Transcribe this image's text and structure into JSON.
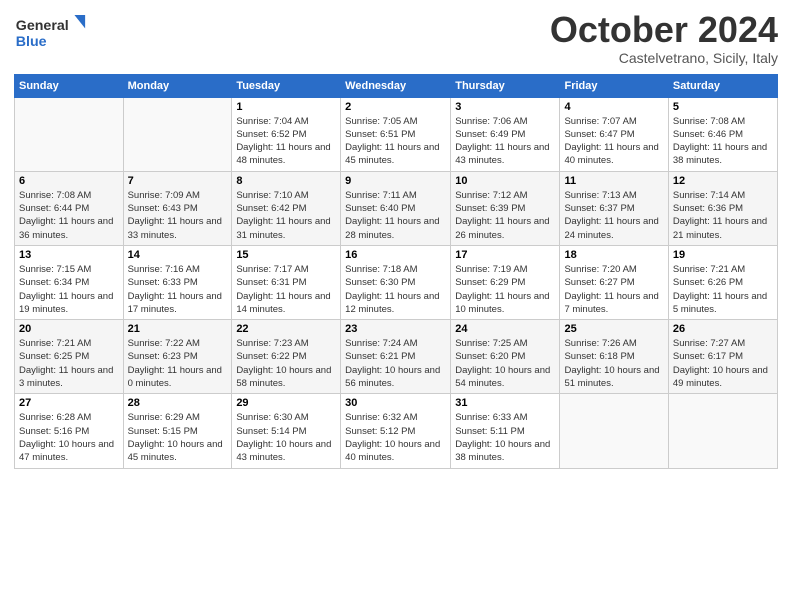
{
  "header": {
    "logo_general": "General",
    "logo_blue": "Blue",
    "title": "October 2024",
    "location": "Castelvetrano, Sicily, Italy"
  },
  "weekdays": [
    "Sunday",
    "Monday",
    "Tuesday",
    "Wednesday",
    "Thursday",
    "Friday",
    "Saturday"
  ],
  "weeks": [
    [
      {
        "day": "",
        "sunrise": "",
        "sunset": "",
        "daylight": ""
      },
      {
        "day": "",
        "sunrise": "",
        "sunset": "",
        "daylight": ""
      },
      {
        "day": "1",
        "sunrise": "Sunrise: 7:04 AM",
        "sunset": "Sunset: 6:52 PM",
        "daylight": "Daylight: 11 hours and 48 minutes."
      },
      {
        "day": "2",
        "sunrise": "Sunrise: 7:05 AM",
        "sunset": "Sunset: 6:51 PM",
        "daylight": "Daylight: 11 hours and 45 minutes."
      },
      {
        "day": "3",
        "sunrise": "Sunrise: 7:06 AM",
        "sunset": "Sunset: 6:49 PM",
        "daylight": "Daylight: 11 hours and 43 minutes."
      },
      {
        "day": "4",
        "sunrise": "Sunrise: 7:07 AM",
        "sunset": "Sunset: 6:47 PM",
        "daylight": "Daylight: 11 hours and 40 minutes."
      },
      {
        "day": "5",
        "sunrise": "Sunrise: 7:08 AM",
        "sunset": "Sunset: 6:46 PM",
        "daylight": "Daylight: 11 hours and 38 minutes."
      }
    ],
    [
      {
        "day": "6",
        "sunrise": "Sunrise: 7:08 AM",
        "sunset": "Sunset: 6:44 PM",
        "daylight": "Daylight: 11 hours and 36 minutes."
      },
      {
        "day": "7",
        "sunrise": "Sunrise: 7:09 AM",
        "sunset": "Sunset: 6:43 PM",
        "daylight": "Daylight: 11 hours and 33 minutes."
      },
      {
        "day": "8",
        "sunrise": "Sunrise: 7:10 AM",
        "sunset": "Sunset: 6:42 PM",
        "daylight": "Daylight: 11 hours and 31 minutes."
      },
      {
        "day": "9",
        "sunrise": "Sunrise: 7:11 AM",
        "sunset": "Sunset: 6:40 PM",
        "daylight": "Daylight: 11 hours and 28 minutes."
      },
      {
        "day": "10",
        "sunrise": "Sunrise: 7:12 AM",
        "sunset": "Sunset: 6:39 PM",
        "daylight": "Daylight: 11 hours and 26 minutes."
      },
      {
        "day": "11",
        "sunrise": "Sunrise: 7:13 AM",
        "sunset": "Sunset: 6:37 PM",
        "daylight": "Daylight: 11 hours and 24 minutes."
      },
      {
        "day": "12",
        "sunrise": "Sunrise: 7:14 AM",
        "sunset": "Sunset: 6:36 PM",
        "daylight": "Daylight: 11 hours and 21 minutes."
      }
    ],
    [
      {
        "day": "13",
        "sunrise": "Sunrise: 7:15 AM",
        "sunset": "Sunset: 6:34 PM",
        "daylight": "Daylight: 11 hours and 19 minutes."
      },
      {
        "day": "14",
        "sunrise": "Sunrise: 7:16 AM",
        "sunset": "Sunset: 6:33 PM",
        "daylight": "Daylight: 11 hours and 17 minutes."
      },
      {
        "day": "15",
        "sunrise": "Sunrise: 7:17 AM",
        "sunset": "Sunset: 6:31 PM",
        "daylight": "Daylight: 11 hours and 14 minutes."
      },
      {
        "day": "16",
        "sunrise": "Sunrise: 7:18 AM",
        "sunset": "Sunset: 6:30 PM",
        "daylight": "Daylight: 11 hours and 12 minutes."
      },
      {
        "day": "17",
        "sunrise": "Sunrise: 7:19 AM",
        "sunset": "Sunset: 6:29 PM",
        "daylight": "Daylight: 11 hours and 10 minutes."
      },
      {
        "day": "18",
        "sunrise": "Sunrise: 7:20 AM",
        "sunset": "Sunset: 6:27 PM",
        "daylight": "Daylight: 11 hours and 7 minutes."
      },
      {
        "day": "19",
        "sunrise": "Sunrise: 7:21 AM",
        "sunset": "Sunset: 6:26 PM",
        "daylight": "Daylight: 11 hours and 5 minutes."
      }
    ],
    [
      {
        "day": "20",
        "sunrise": "Sunrise: 7:21 AM",
        "sunset": "Sunset: 6:25 PM",
        "daylight": "Daylight: 11 hours and 3 minutes."
      },
      {
        "day": "21",
        "sunrise": "Sunrise: 7:22 AM",
        "sunset": "Sunset: 6:23 PM",
        "daylight": "Daylight: 11 hours and 0 minutes."
      },
      {
        "day": "22",
        "sunrise": "Sunrise: 7:23 AM",
        "sunset": "Sunset: 6:22 PM",
        "daylight": "Daylight: 10 hours and 58 minutes."
      },
      {
        "day": "23",
        "sunrise": "Sunrise: 7:24 AM",
        "sunset": "Sunset: 6:21 PM",
        "daylight": "Daylight: 10 hours and 56 minutes."
      },
      {
        "day": "24",
        "sunrise": "Sunrise: 7:25 AM",
        "sunset": "Sunset: 6:20 PM",
        "daylight": "Daylight: 10 hours and 54 minutes."
      },
      {
        "day": "25",
        "sunrise": "Sunrise: 7:26 AM",
        "sunset": "Sunset: 6:18 PM",
        "daylight": "Daylight: 10 hours and 51 minutes."
      },
      {
        "day": "26",
        "sunrise": "Sunrise: 7:27 AM",
        "sunset": "Sunset: 6:17 PM",
        "daylight": "Daylight: 10 hours and 49 minutes."
      }
    ],
    [
      {
        "day": "27",
        "sunrise": "Sunrise: 6:28 AM",
        "sunset": "Sunset: 5:16 PM",
        "daylight": "Daylight: 10 hours and 47 minutes."
      },
      {
        "day": "28",
        "sunrise": "Sunrise: 6:29 AM",
        "sunset": "Sunset: 5:15 PM",
        "daylight": "Daylight: 10 hours and 45 minutes."
      },
      {
        "day": "29",
        "sunrise": "Sunrise: 6:30 AM",
        "sunset": "Sunset: 5:14 PM",
        "daylight": "Daylight: 10 hours and 43 minutes."
      },
      {
        "day": "30",
        "sunrise": "Sunrise: 6:32 AM",
        "sunset": "Sunset: 5:12 PM",
        "daylight": "Daylight: 10 hours and 40 minutes."
      },
      {
        "day": "31",
        "sunrise": "Sunrise: 6:33 AM",
        "sunset": "Sunset: 5:11 PM",
        "daylight": "Daylight: 10 hours and 38 minutes."
      },
      {
        "day": "",
        "sunrise": "",
        "sunset": "",
        "daylight": ""
      },
      {
        "day": "",
        "sunrise": "",
        "sunset": "",
        "daylight": ""
      }
    ]
  ]
}
